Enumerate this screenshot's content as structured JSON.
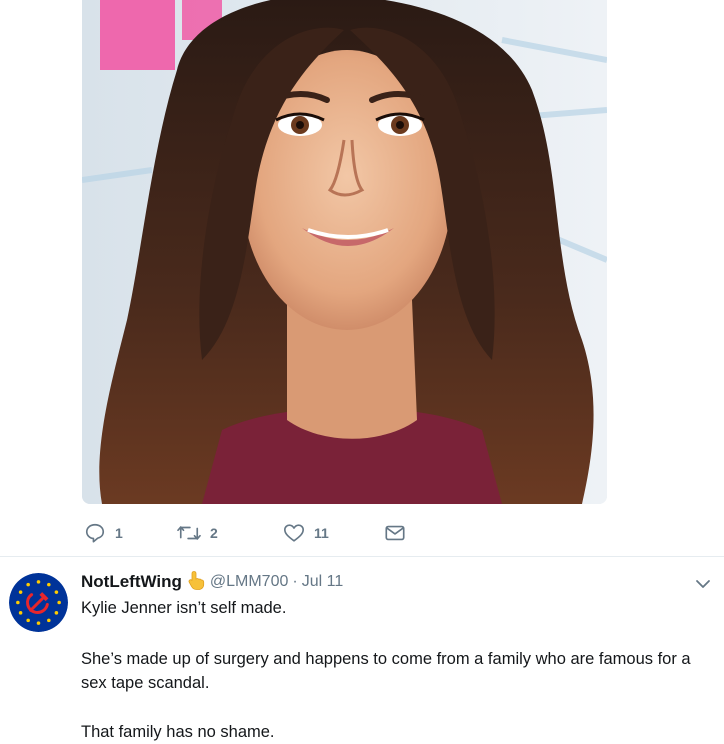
{
  "first_tweet": {
    "photo": {
      "alt": "portrait photo of a woman with long brown wavy hair"
    },
    "actions": {
      "reply": {
        "icon": "reply-icon",
        "count": "1"
      },
      "retweet": {
        "icon": "retweet-icon",
        "count": "2"
      },
      "like": {
        "icon": "heart-icon",
        "count": "11"
      },
      "message": {
        "icon": "envelope-icon"
      }
    }
  },
  "second_tweet": {
    "avatar": {
      "icon": "hammer-sickle-stars-avatar",
      "bg": "#003399",
      "star_color": "#ffcc00"
    },
    "display_name": "NotLeftWing",
    "name_emoji": "👆",
    "handle": "@LMM700",
    "separator": "·",
    "timestamp": "Jul 11",
    "more_icon": "chevron-down-icon",
    "paragraphs": [
      "Kylie Jenner isn’t self made.",
      "She’s made up of surgery and happens to come from a family who are famous for a sex tape scandal.",
      "That family has no shame."
    ]
  },
  "colors": {
    "text": "#14171a",
    "muted": "#657786",
    "divider": "#e6ecf0"
  }
}
